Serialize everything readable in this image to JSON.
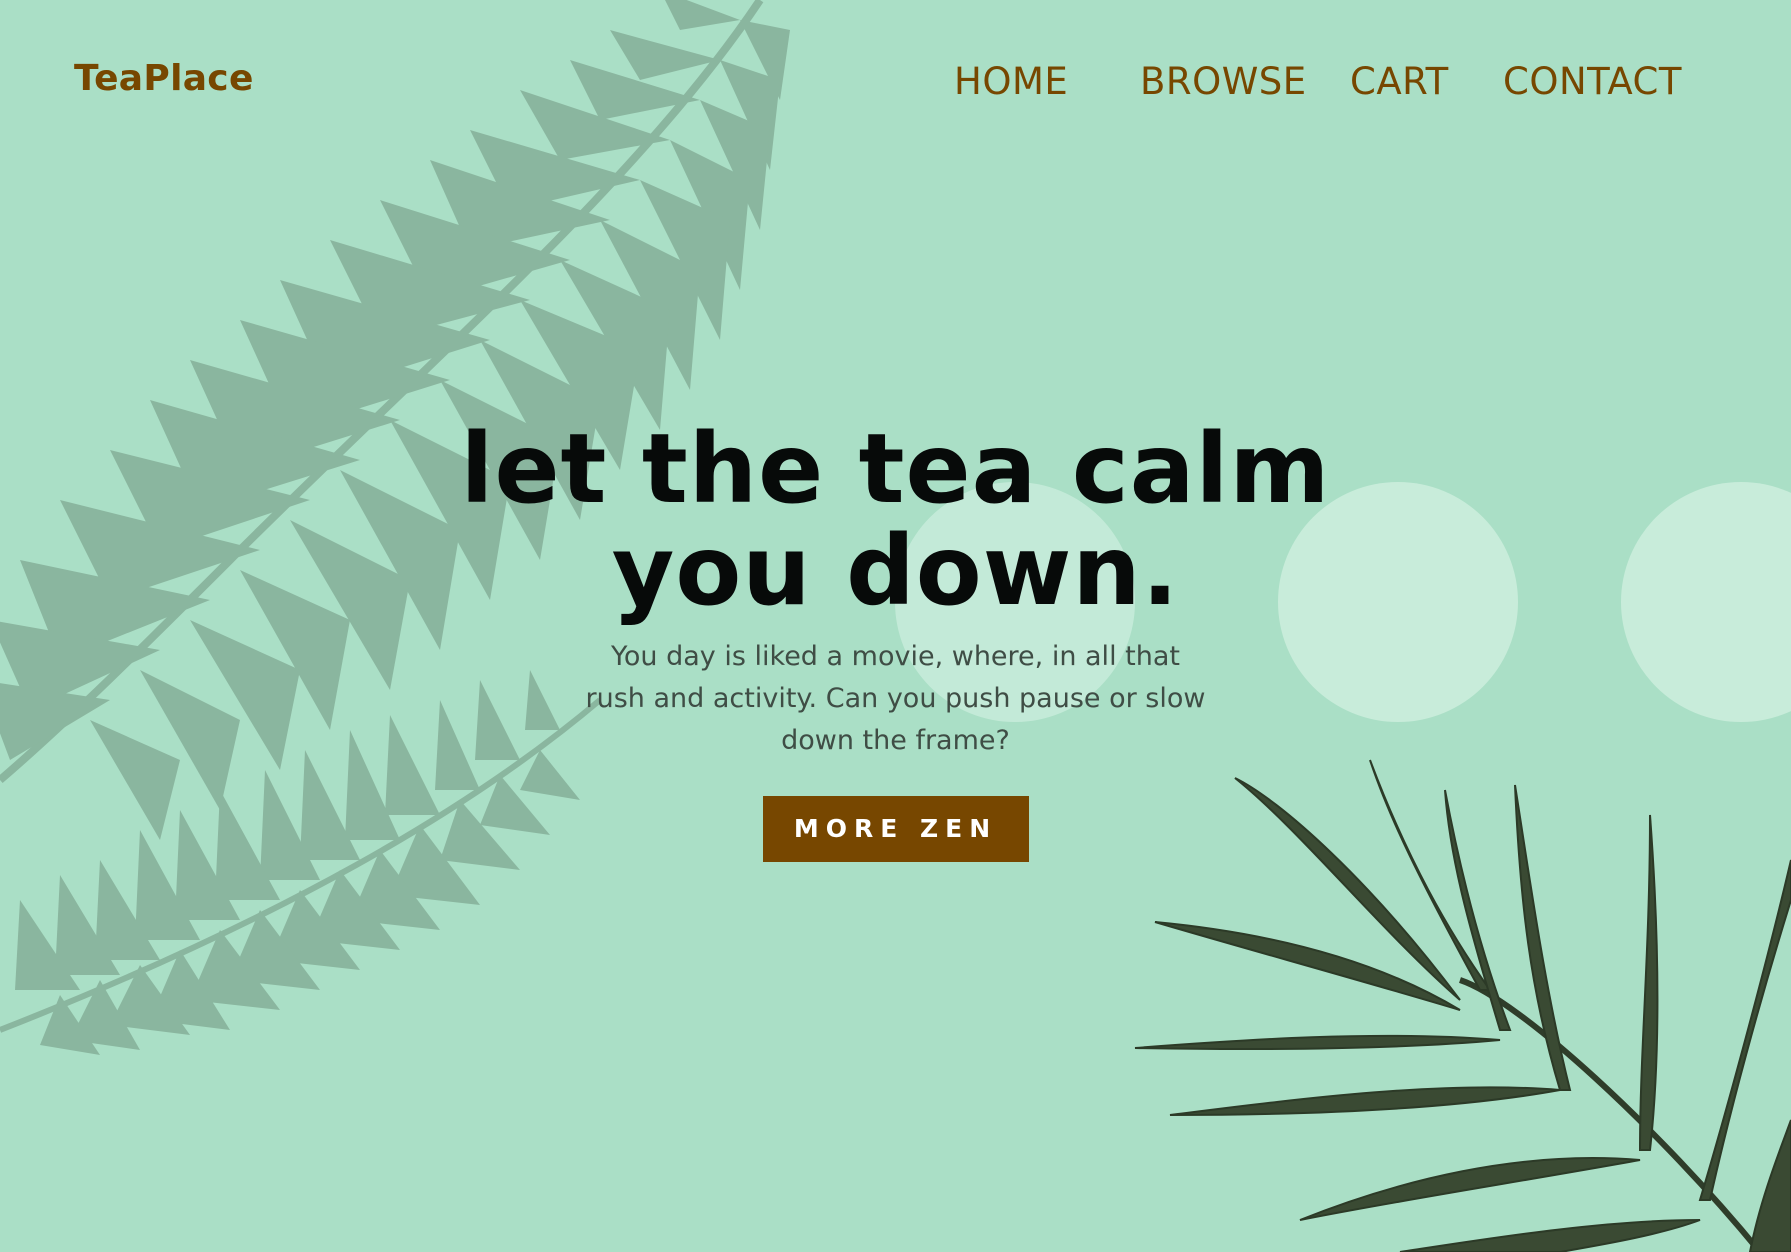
{
  "brand": {
    "name": "TeaPlace"
  },
  "nav": {
    "items": [
      {
        "label": "HOME"
      },
      {
        "label": "BROWSE"
      },
      {
        "label": "CART"
      },
      {
        "label": "CONTACT"
      }
    ]
  },
  "hero": {
    "headline_line1": "let the tea calm",
    "headline_line2": "you down.",
    "subtext": "You day is liked a movie, where, in all that rush and activity. Can you push pause or slow down the frame?",
    "cta_label": "MORE ZEN"
  },
  "colors": {
    "background": "#aadfc6",
    "brand": "#774700",
    "headline": "#070a09",
    "fern": "#8ab69f",
    "palm": "#3a4a33",
    "circle": "#c8ecda"
  },
  "decorations": {
    "left": "fern-leaf-illustration",
    "right": "palm-leaf-illustration"
  }
}
